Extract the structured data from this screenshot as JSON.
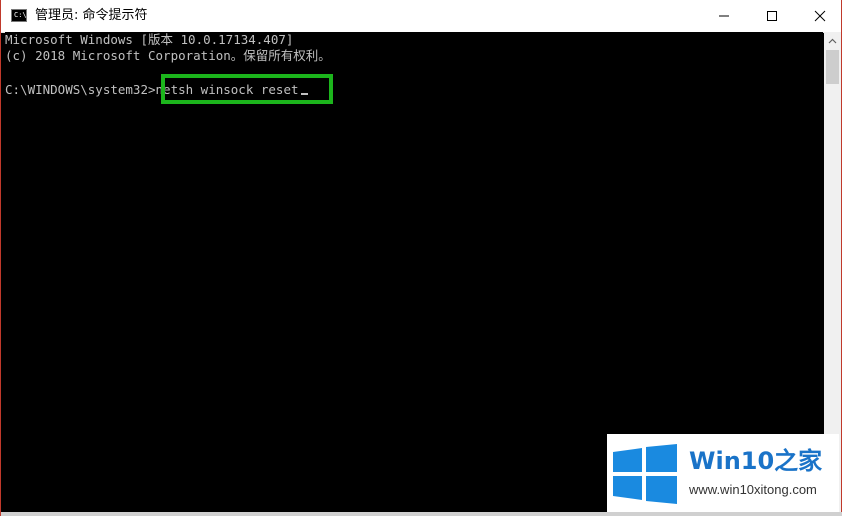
{
  "window": {
    "title": "管理员: 命令提示符",
    "icon_text": "C:\\",
    "controls": [
      "minimize-icon",
      "maximize-icon",
      "close-icon"
    ]
  },
  "console": {
    "line1": "Microsoft Windows [版本 10.0.17134.407]",
    "line2": "(c) 2018 Microsoft Corporation。保留所有权利。",
    "prompt": "C:\\WINDOWS\\system32>",
    "command": "netsh winsock reset",
    "text_color": "#c0c0c0",
    "background": "#000000",
    "highlight_color": "#1cb51c"
  },
  "watermark": {
    "title": "Win10之家",
    "url": "www.win10xitong.com",
    "brand_color": "#1a73c8"
  }
}
